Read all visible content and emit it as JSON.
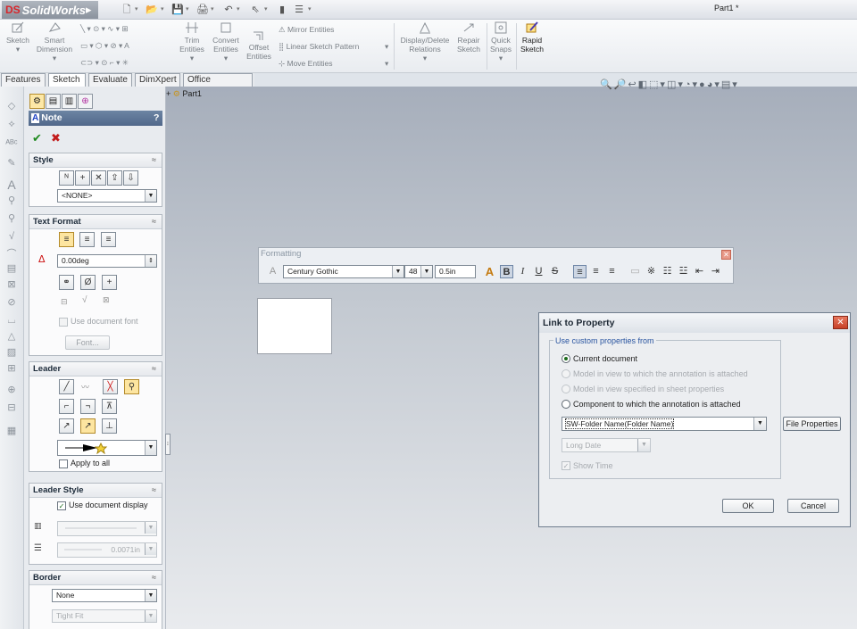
{
  "app": {
    "logo_text": "SolidWorks",
    "doc_title": "Part1 *"
  },
  "ribbon": {
    "sketch": "Sketch",
    "smart_dimension": [
      "Smart",
      "Dimension"
    ],
    "trim": [
      "Trim",
      "Entities"
    ],
    "convert": [
      "Convert",
      "Entities"
    ],
    "offset": [
      "Offset",
      "Entities"
    ],
    "mirror": "Mirror Entities",
    "linear_pattern": "Linear Sketch Pattern",
    "move": "Move Entities",
    "display_delete": [
      "Display/Delete",
      "Relations"
    ],
    "repair": [
      "Repair",
      "Sketch"
    ],
    "quick_snaps": [
      "Quick",
      "Snaps"
    ],
    "rapid_sketch": [
      "Rapid",
      "Sketch"
    ]
  },
  "tabs": [
    "Features",
    "Sketch",
    "Evaluate",
    "DimXpert",
    "Office Products"
  ],
  "active_tab": "Sketch",
  "tree": {
    "root": "Part1"
  },
  "pm": {
    "title": "Note",
    "help": "?",
    "style": {
      "header": "Style",
      "value": "<NONE>"
    },
    "text_format": {
      "header": "Text Format",
      "angle": "0.00deg",
      "use_doc_font": "Use document font",
      "font_btn": "Font..."
    },
    "leader": {
      "header": "Leader",
      "apply_all": "Apply to all"
    },
    "leader_style": {
      "header": "Leader Style",
      "use_doc_display": "Use document display",
      "thickness": "0.0071in"
    },
    "border": {
      "header": "Border",
      "style": "None",
      "size": "Tight Fit"
    }
  },
  "formatting": {
    "title": "Formatting",
    "font": "Century Gothic",
    "size": "48",
    "height": "0.5in"
  },
  "dialog": {
    "title": "Link to Property",
    "group_label": "Use custom properties from",
    "options": [
      {
        "label": "Current document",
        "selected": true,
        "enabled": true
      },
      {
        "label": "Model in view to which the annotation is attached",
        "selected": false,
        "enabled": false
      },
      {
        "label": "Model in view specified in sheet properties",
        "selected": false,
        "enabled": false
      },
      {
        "label": "Component to which the annotation is attached",
        "selected": false,
        "enabled": true
      }
    ],
    "property": "SW-Folder Name(Folder Name)",
    "file_properties": "File Properties",
    "date_format": "Long Date",
    "show_time": "Show Time",
    "ok": "OK",
    "cancel": "Cancel"
  },
  "colors": {
    "accent": "#51688a",
    "canvas_top": "#a6aebb",
    "close_red": "#c63f26"
  }
}
